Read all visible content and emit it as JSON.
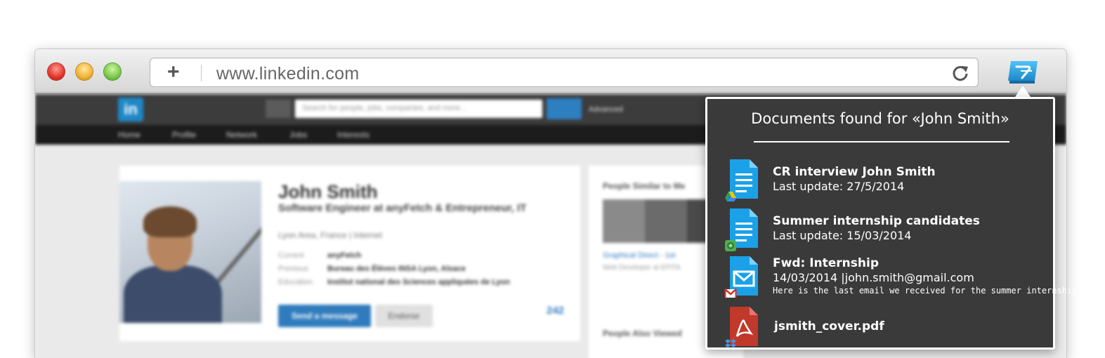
{
  "browser": {
    "url": "www.linkedin.com",
    "new_tab_label": "+"
  },
  "linkedin": {
    "logo": "in",
    "search_placeholder": "Search for people, jobs, companies, and more...",
    "advanced_label": "Advanced",
    "nav": [
      "Home",
      "Profile",
      "Network",
      "Jobs",
      "Interests"
    ],
    "profile": {
      "name": "John Smith",
      "headline": "Software Engineer at anyFetch & Entrepreneur, IT",
      "location": "Lyon Area, France | Internet",
      "rows": [
        {
          "key": "Current",
          "value": "anyFetch"
        },
        {
          "key": "Previous",
          "value": "Bureau des Élèves INSA Lyon, Alsace"
        },
        {
          "key": "Education",
          "value": "Institut national des Sciences appliquées de Lyon"
        }
      ],
      "send_message_label": "Send a message",
      "endorse_label": "Endorse",
      "connections": "242"
    },
    "sidebar": {
      "title": "People Similar to Me",
      "person_name": "Graphical Direct - 1st",
      "person_sub": "Web Developer at EPITA",
      "title2": "People Also Viewed"
    }
  },
  "panel": {
    "title": "Documents found for «John Smith»",
    "documents": [
      {
        "title": "CR interview John Smith",
        "line": "Last update: 27/5/2014",
        "snippet": "",
        "type_icon": "gdoc-file-icon",
        "source_icon": "google-drive-icon"
      },
      {
        "title": "Summer internship candidates",
        "line": "Last update: 15/03/2014",
        "snippet": "",
        "type_icon": "gdoc-file-icon",
        "source_icon": "evernote-icon"
      },
      {
        "title": "Fwd: Internship",
        "line": "14/03/2014 |john.smith@gmail.com",
        "snippet": "Here is the last email we received for the summer internship...",
        "type_icon": "email-file-icon",
        "source_icon": "gmail-icon"
      },
      {
        "title": "jsmith_cover.pdf",
        "line": "",
        "snippet": "",
        "type_icon": "pdf-file-icon",
        "source_icon": "dropbox-icon"
      }
    ]
  },
  "colors": {
    "panel_bg": "#3a3a3a",
    "doc_blue": "#1ba1e8",
    "pdf_red": "#c0392b",
    "linkedin_blue": "#1f88c6"
  }
}
